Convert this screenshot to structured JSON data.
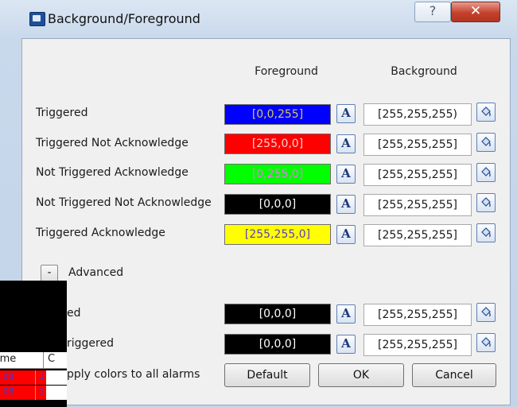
{
  "dialog": {
    "title": "Background/Foreground",
    "help_glyph": "?",
    "close_glyph": "✕"
  },
  "headers": {
    "foreground": "Foreground",
    "background": "Background"
  },
  "rows": [
    {
      "label": "Triggered",
      "fg": "[0,0,255]",
      "fg_color": "#0000ff",
      "fg_text_color": "#d6c65a",
      "bg": "[255,255,255)"
    },
    {
      "label": "Triggered Not Acknowledge",
      "fg": "[255,0,0]",
      "fg_color": "#ff0000",
      "fg_text_color": "#ffd0d0",
      "bg": "[255,255,255]"
    },
    {
      "label": "Not Triggered Acknowledge",
      "fg": "[0,255,0]",
      "fg_color": "#00ff00",
      "fg_text_color": "#ff66ff",
      "bg": "[255,255,255]"
    },
    {
      "label": "Not Triggered Not Acknowledge",
      "fg": "[0,0,0]",
      "fg_color": "#000000",
      "fg_text_color": "#ffffff",
      "bg": "[255,255,255]"
    },
    {
      "label": "Triggered Acknowledge",
      "fg": "[255,255,0]",
      "fg_color": "#ffff00",
      "fg_text_color": "#5a3cc9",
      "bg": "[255,255,255]"
    }
  ],
  "advanced": {
    "toggle_glyph": "-",
    "label": "Advanced",
    "rows": [
      {
        "label": "ed",
        "fg": "[0,0,0]",
        "fg_color": "#000000",
        "fg_text_color": "#ffffff",
        "bg": "[255,255,255]"
      },
      {
        "label": "riggered",
        "fg": "[0,0,0]",
        "fg_color": "#000000",
        "fg_text_color": "#ffffff",
        "bg": "[255,255,255]"
      }
    ]
  },
  "footer": {
    "apply_label": "pply colors to all alarms",
    "default_label": "Default",
    "ok_label": "OK",
    "cancel_label": "Cancel"
  },
  "background_window": {
    "header": {
      "col1": "ime",
      "col2": "C"
    },
    "rows": [
      {
        "col1": ".08",
        "col2": "1"
      },
      {
        "col1": ".08",
        "col2": "1"
      }
    ]
  },
  "icons": {
    "foreground_button": "font-color-icon",
    "background_button": "paint-bucket-icon"
  },
  "glyphs": {
    "font_color": "A"
  }
}
